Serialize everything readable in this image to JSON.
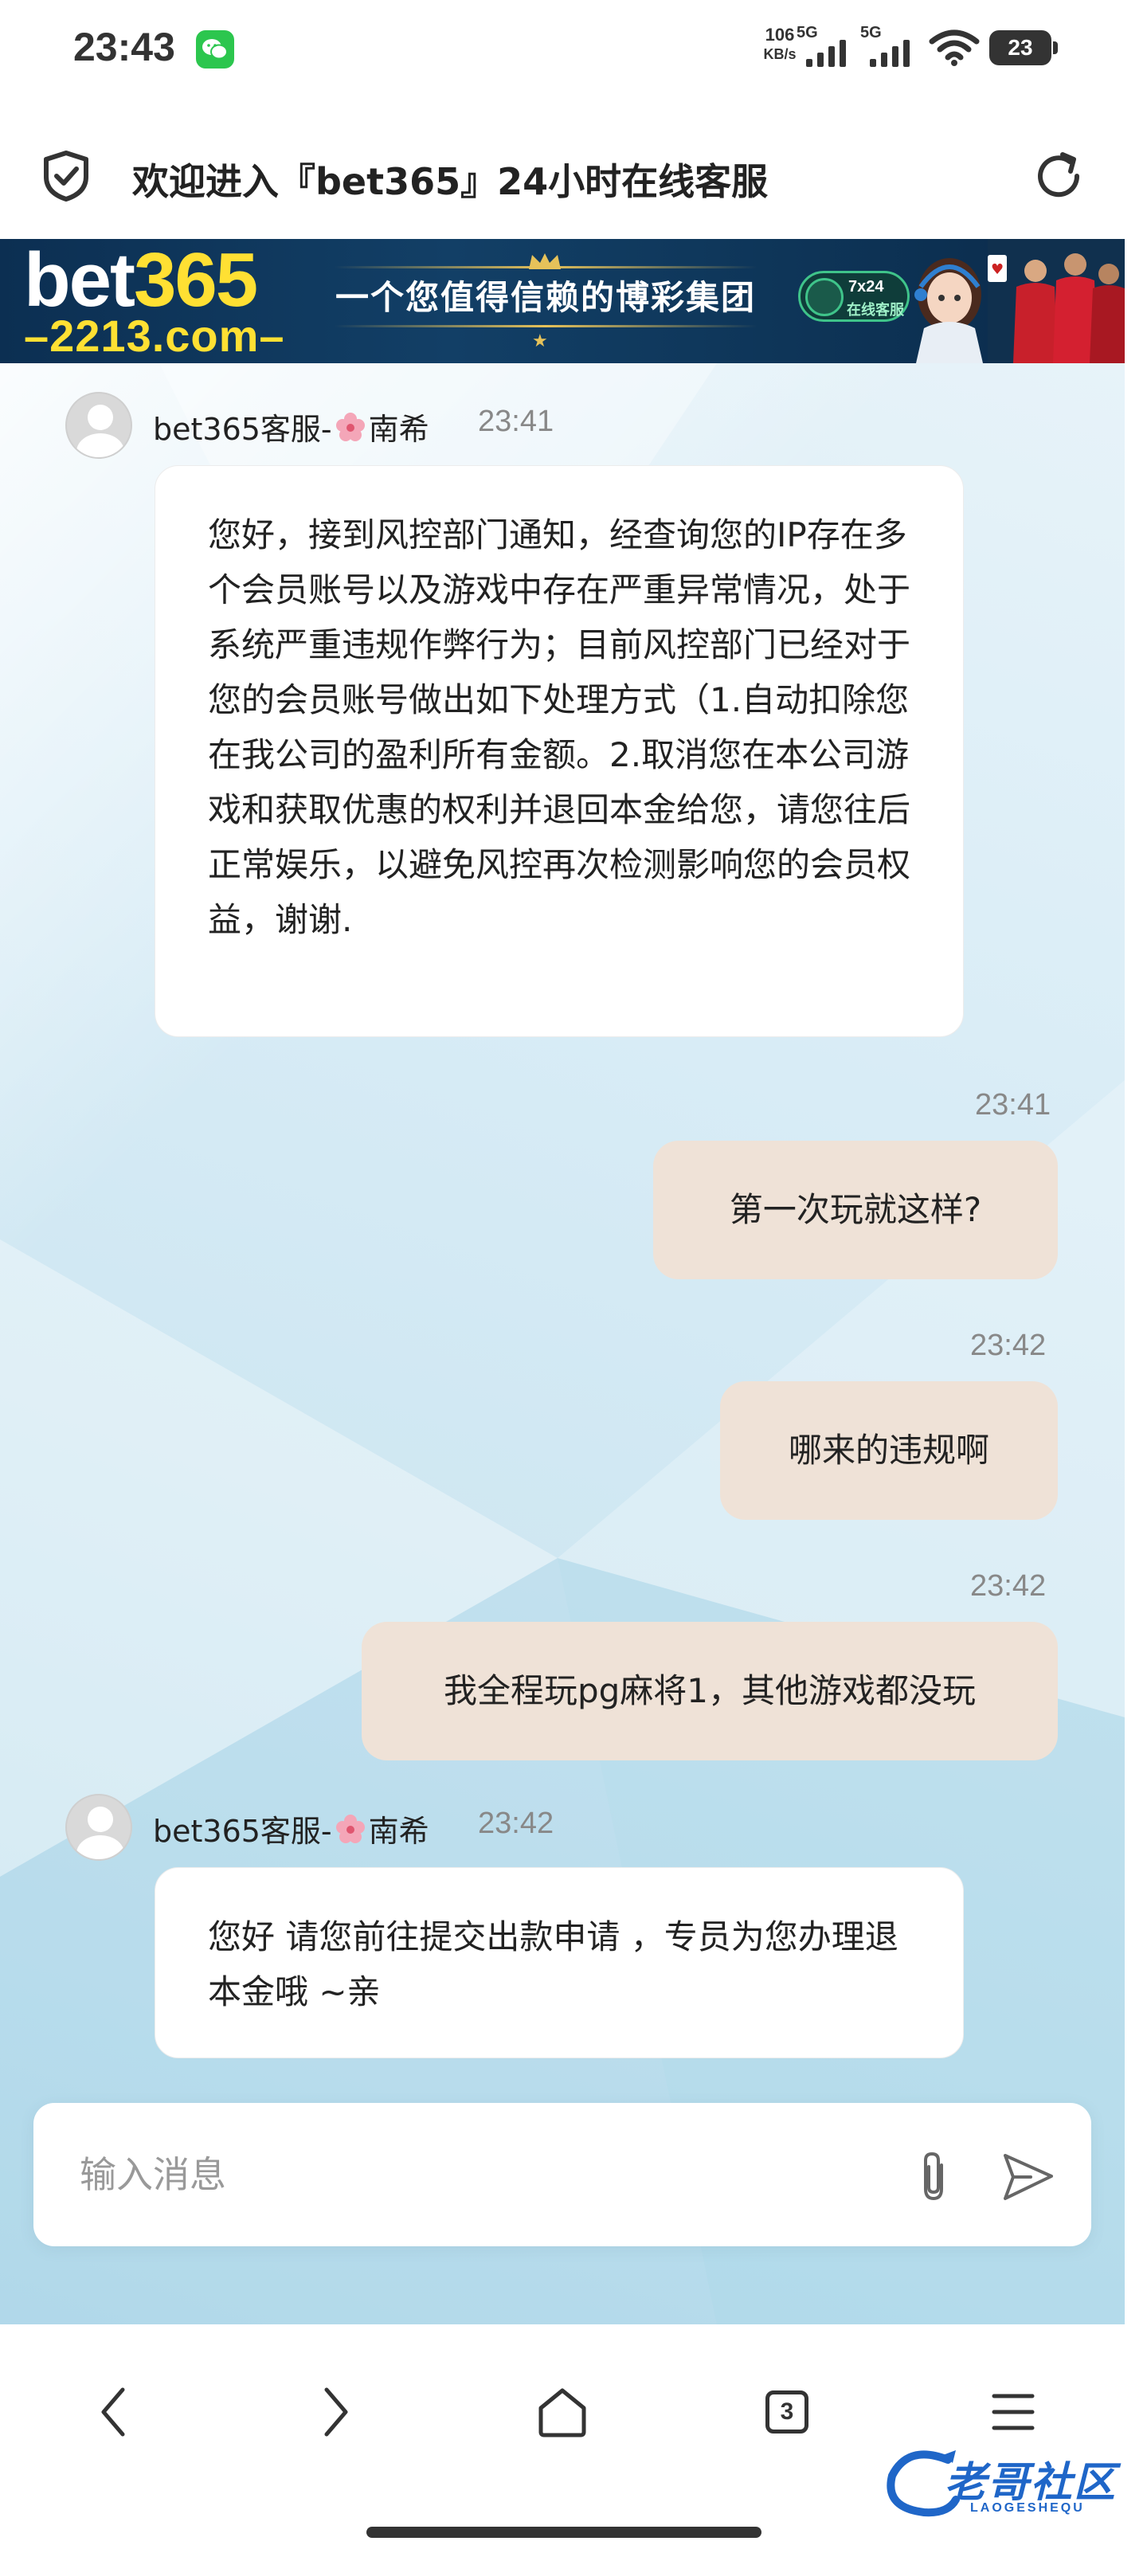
{
  "status_bar": {
    "time": "23:43",
    "net_speed_value": "106",
    "net_speed_unit": "KB/s",
    "sim1_label": "5G",
    "sim2_label": "5G",
    "battery_level": "23",
    "notification_app": "wechat-icon"
  },
  "header": {
    "title": "欢迎进入『bet365』24小时在线客服",
    "left_icon": "shield-check-icon",
    "right_icon": "reload-icon"
  },
  "banner": {
    "logo_main_prefix": "bet",
    "logo_main_accent": "365",
    "logo_sub": "–2213.com–",
    "slogan": "一个您值得信赖的博彩集团",
    "service_badge_line1": "7x24",
    "service_badge_line2": "在线客服",
    "colors": {
      "background": "#0c2f52",
      "accent": "#ffe033"
    }
  },
  "agent": {
    "name": "bet365客服-",
    "name_suffix": "南希"
  },
  "messages": [
    {
      "side": "left",
      "time": "23:41",
      "text": "您好，接到风控部门通知，经查询您的IP存在多个会员账号以及游戏中存在严重异常情况，处于系统严重违规作弊行为；目前风控部门已经对于您的会员账号做出如下处理方式（1.自动扣除您在我公司的盈利所有金额。2.取消您在本公司游戏和获取优惠的权利并退回本金给您，请您往后正常娱乐，以避免风控再次检测影响您的会员权益，谢谢."
    },
    {
      "side": "right",
      "time": "23:41",
      "text": "第一次玩就这样?"
    },
    {
      "side": "right",
      "time": "23:42",
      "text": "哪来的违规啊"
    },
    {
      "side": "right",
      "time": "23:42",
      "text": "我全程玩pg麻将1，其他游戏都没玩"
    },
    {
      "side": "left",
      "time": "23:42",
      "text": "您好 请您前往提交出款申请 ，专员为您办理退本金哦 ~亲"
    }
  ],
  "input": {
    "placeholder": "输入消息",
    "value": ""
  },
  "bottom_nav": {
    "back_icon": "chevron-left-icon",
    "forward_icon": "chevron-right-icon",
    "home_icon": "home-icon",
    "tabs_count": "3",
    "menu_icon": "menu-icon"
  },
  "watermark": {
    "text": "老哥社区",
    "sub": "LAOGESHEQU"
  },
  "colors": {
    "right_bubble": "#efe2d7",
    "left_bubble": "#ffffff",
    "chat_background": "#d8ecf6"
  }
}
